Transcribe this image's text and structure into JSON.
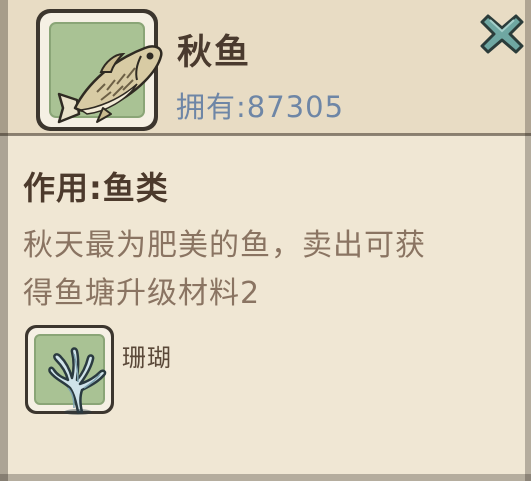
{
  "item": {
    "name": "秋鱼",
    "owned_label": "拥有:",
    "owned_count": "87305",
    "icon": "fish-icon"
  },
  "close": {
    "icon": "close-icon"
  },
  "usage": {
    "label": "作用:鱼类"
  },
  "description": {
    "line1": "秋天最为肥美的鱼，卖出可获",
    "line2": "得鱼塘升级材料2"
  },
  "related": {
    "name": "珊瑚",
    "icon": "coral-icon"
  },
  "colors": {
    "background": "#f0e7d4",
    "owned_text": "#6e86a6",
    "title_text": "#4a3a2e",
    "desc_text": "#8a7462",
    "tile_green": "#a9c294",
    "close_teal": "#6fa7a2"
  }
}
